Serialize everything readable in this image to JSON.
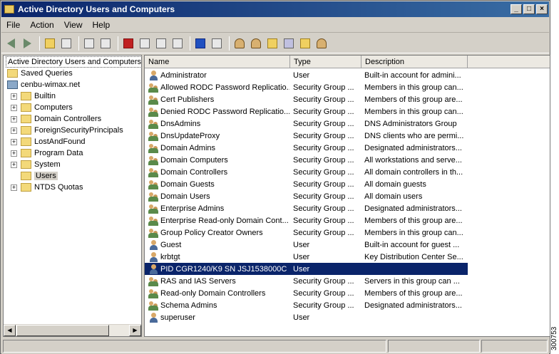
{
  "window": {
    "title": "Active Directory Users and Computers"
  },
  "menu": [
    "File",
    "Action",
    "View",
    "Help"
  ],
  "tree": {
    "root": "Active Directory Users and Computers",
    "saved": "Saved Queries",
    "domain": "cenbu-wimax.net",
    "children": [
      "Builtin",
      "Computers",
      "Domain Controllers",
      "ForeignSecurityPrincipals",
      "LostAndFound",
      "Program Data",
      "System",
      "Users",
      "NTDS Quotas"
    ]
  },
  "columns": [
    "Name",
    "Type",
    "Description"
  ],
  "rows": [
    {
      "name": "Administrator",
      "type": "User",
      "desc": "Built-in account for admini...",
      "icon": "user-icon"
    },
    {
      "name": "Allowed RODC Password Replicatio...",
      "type": "Security Group ...",
      "desc": "Members in this group can...",
      "icon": "group-icon"
    },
    {
      "name": "Cert Publishers",
      "type": "Security Group ...",
      "desc": "Members of this group are...",
      "icon": "group-icon"
    },
    {
      "name": "Denied RODC Password Replicatio...",
      "type": "Security Group ...",
      "desc": "Members in this group can...",
      "icon": "group-icon"
    },
    {
      "name": "DnsAdmins",
      "type": "Security Group ...",
      "desc": "DNS Administrators Group",
      "icon": "group-icon"
    },
    {
      "name": "DnsUpdateProxy",
      "type": "Security Group ...",
      "desc": "DNS clients who are permi...",
      "icon": "group-icon"
    },
    {
      "name": "Domain Admins",
      "type": "Security Group ...",
      "desc": "Designated administrators...",
      "icon": "group-icon"
    },
    {
      "name": "Domain Computers",
      "type": "Security Group ...",
      "desc": "All workstations and serve...",
      "icon": "group-icon"
    },
    {
      "name": "Domain Controllers",
      "type": "Security Group ...",
      "desc": "All domain controllers in th...",
      "icon": "group-icon"
    },
    {
      "name": "Domain Guests",
      "type": "Security Group ...",
      "desc": "All domain guests",
      "icon": "group-icon"
    },
    {
      "name": "Domain Users",
      "type": "Security Group ...",
      "desc": "All domain users",
      "icon": "group-icon"
    },
    {
      "name": "Enterprise Admins",
      "type": "Security Group ...",
      "desc": "Designated administrators...",
      "icon": "group-icon"
    },
    {
      "name": "Enterprise Read-only Domain Cont...",
      "type": "Security Group ...",
      "desc": "Members of this group are...",
      "icon": "group-icon"
    },
    {
      "name": "Group Policy Creator Owners",
      "type": "Security Group ...",
      "desc": "Members in this group can...",
      "icon": "group-icon"
    },
    {
      "name": "Guest",
      "type": "User",
      "desc": "Built-in account for guest ...",
      "icon": "user-icon"
    },
    {
      "name": "krbtgt",
      "type": "User",
      "desc": "Key Distribution Center Se...",
      "icon": "user-icon"
    },
    {
      "name": "PID CGR1240/K9 SN JSJ1538000C",
      "type": "User",
      "desc": "",
      "icon": "user-icon",
      "selected": true
    },
    {
      "name": "RAS and IAS Servers",
      "type": "Security Group ...",
      "desc": "Servers in this group can ...",
      "icon": "group-icon"
    },
    {
      "name": "Read-only Domain Controllers",
      "type": "Security Group ...",
      "desc": "Members of this group are...",
      "icon": "group-icon"
    },
    {
      "name": "Schema Admins",
      "type": "Security Group ...",
      "desc": "Designated administrators...",
      "icon": "group-icon"
    },
    {
      "name": "superuser",
      "type": "User",
      "desc": "",
      "icon": "user-icon"
    }
  ],
  "figure_id": "300753"
}
